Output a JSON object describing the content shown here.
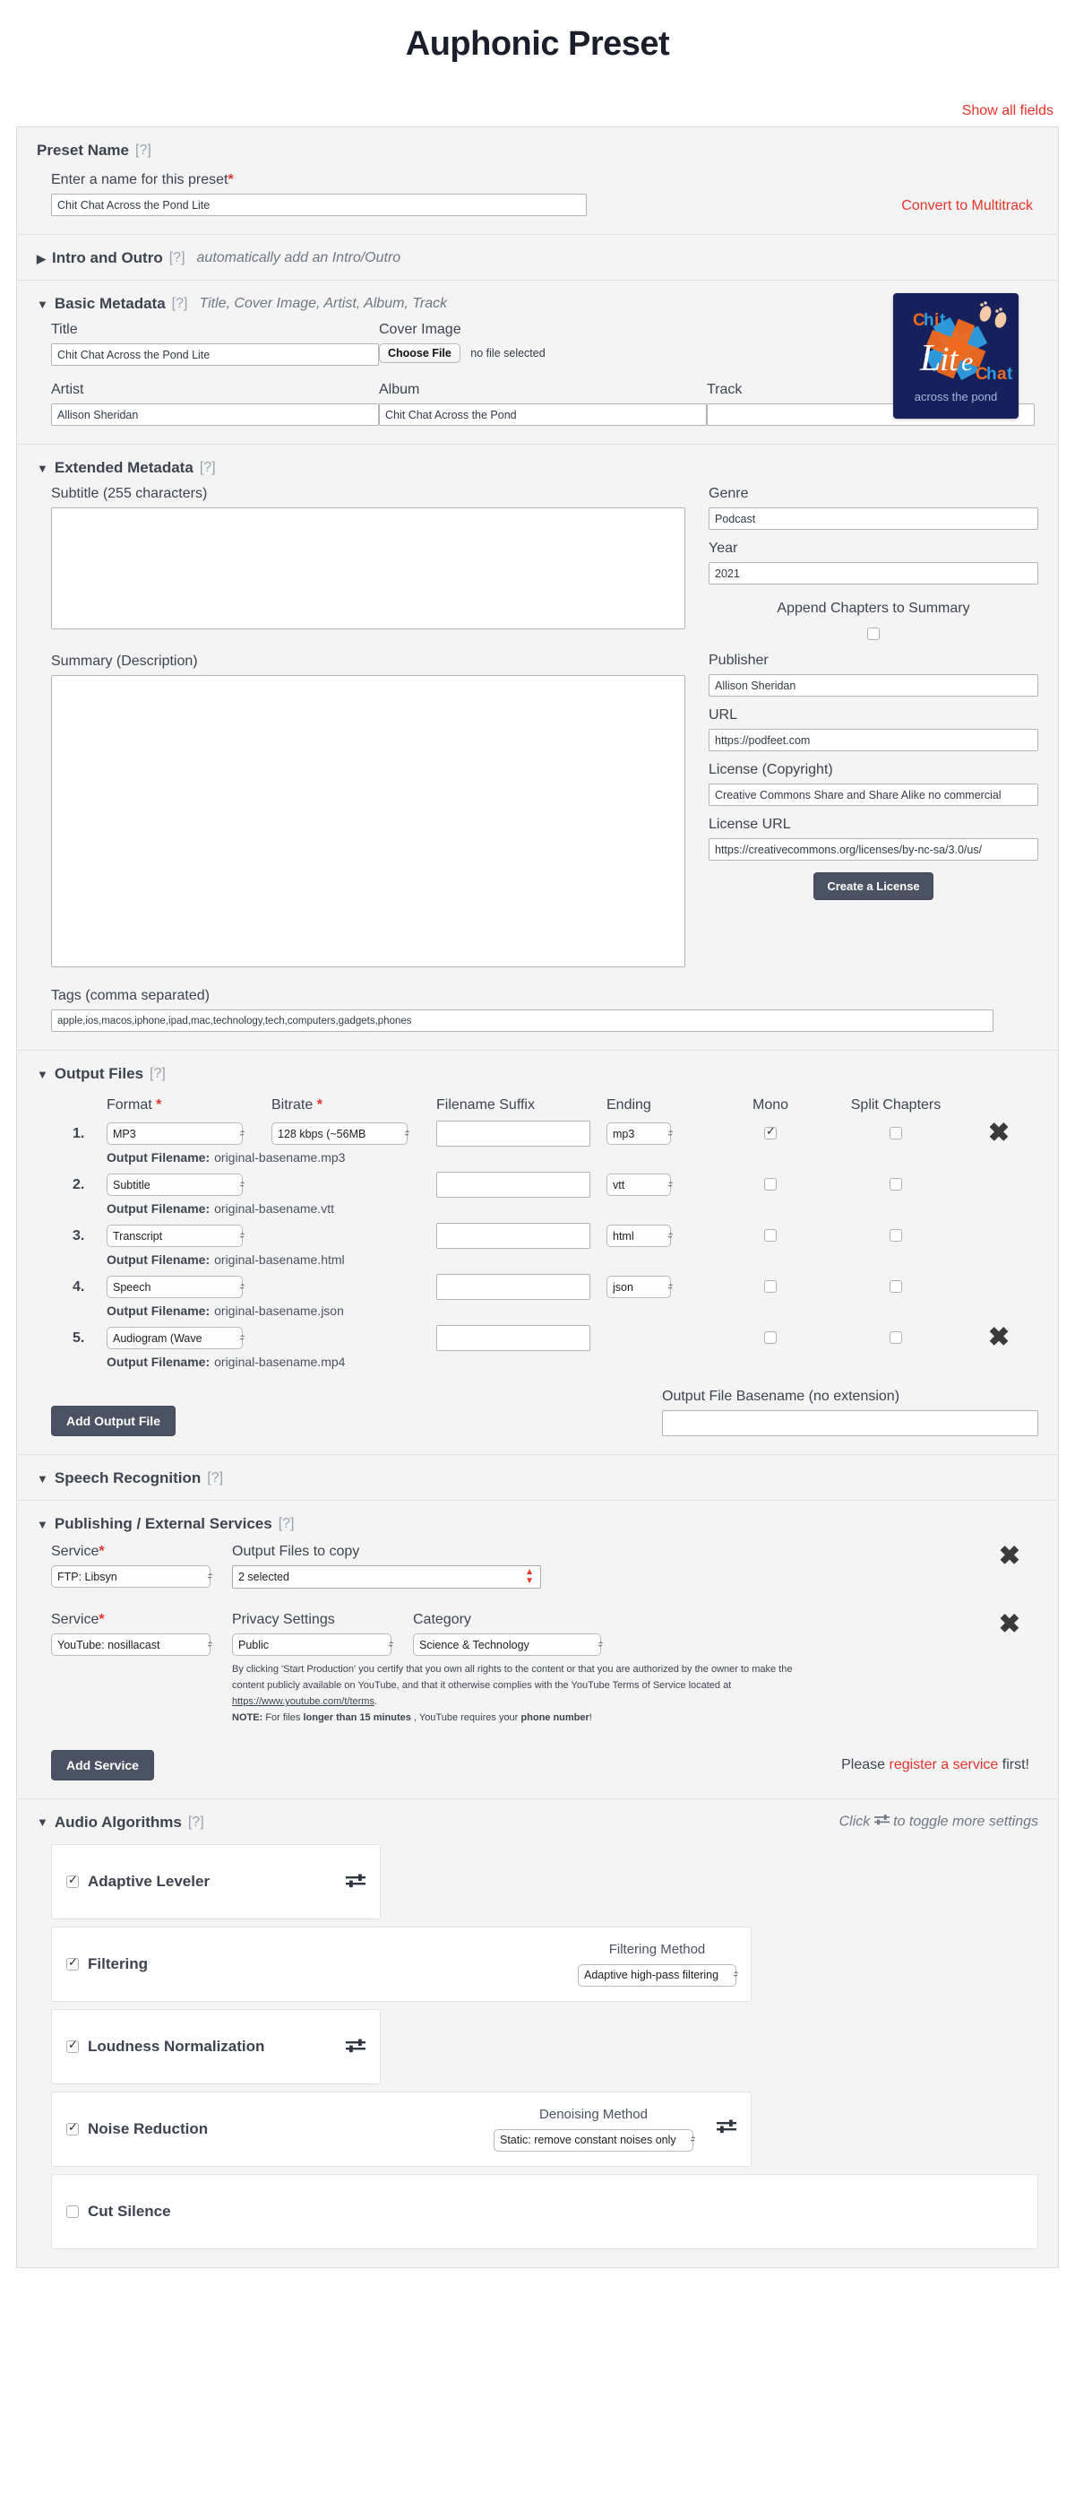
{
  "header": {
    "title": "Auphonic Preset",
    "show_all_fields": "Show all fields"
  },
  "preset_name": {
    "section_title": "Preset Name",
    "help": "[?]",
    "field_label": "Enter a name for this preset",
    "required_mark": "*",
    "value": "Chit Chat Across the Pond Lite",
    "convert_link": "Convert to Multitrack"
  },
  "intro_outro": {
    "section_title": "Intro and Outro",
    "help": "[?]",
    "hint": "automatically add an Intro/Outro",
    "caret": "▶"
  },
  "basic_metadata": {
    "section_title": "Basic Metadata",
    "help": "[?]",
    "hint": "Title, Cover Image, Artist, Album, Track",
    "caret": "▼",
    "title_label": "Title",
    "title_value": "Chit Chat Across the Pond Lite",
    "cover_label": "Cover Image",
    "choose_file": "Choose File",
    "no_file": "no file selected",
    "artist_label": "Artist",
    "artist_value": "Allison Sheridan",
    "album_label": "Album",
    "album_value": "Chit Chat Across the Pond",
    "track_label": "Track",
    "track_value": "",
    "cover_art": {
      "chit": "Chit",
      "lite": "Lite",
      "chat": "Chat",
      "tagline": "across the pond",
      "bg": "#16205a",
      "orange": "#f06a1e",
      "blue": "#2f9ee0"
    }
  },
  "extended_metadata": {
    "section_title": "Extended Metadata",
    "help": "[?]",
    "caret": "▼",
    "subtitle_label": "Subtitle (255 characters)",
    "subtitle_value": "",
    "genre_label": "Genre",
    "genre_value": "Podcast",
    "year_label": "Year",
    "year_value": "2021",
    "append_chapters_label": "Append Chapters to Summary",
    "append_chapters_checked": false,
    "summary_label": "Summary (Description)",
    "summary_value": "",
    "publisher_label": "Publisher",
    "publisher_value": "Allison Sheridan",
    "url_label": "URL",
    "url_value": "https://podfeet.com",
    "license_label": "License (Copyright)",
    "license_value": "Creative Commons Share and Share Alike no commercial",
    "license_url_label": "License URL",
    "license_url_value": "https://creativecommons.org/licenses/by-nc-sa/3.0/us/",
    "create_license_button": "Create a License",
    "tags_label": "Tags (comma separated)",
    "tags_value": "apple,ios,macos,iphone,ipad,mac,technology,tech,computers,gadgets,phones"
  },
  "output_files": {
    "section_title": "Output Files",
    "help": "[?]",
    "caret": "▼",
    "columns": {
      "format": "Format",
      "bitrate": "Bitrate",
      "suffix": "Filename Suffix",
      "ending": "Ending",
      "mono": "Mono",
      "split": "Split Chapters"
    },
    "rows": [
      {
        "index": "1.",
        "format": "MP3",
        "bitrate": "128 kbps (~56MB",
        "suffix": "",
        "ending": "mp3",
        "mono": true,
        "split": false,
        "has_delete": true,
        "filename_label": "Output Filename:",
        "filename_value": "original-basename.mp3"
      },
      {
        "index": "2.",
        "format": "Subtitle",
        "bitrate": "",
        "suffix": "",
        "ending": "vtt",
        "mono": false,
        "split": false,
        "has_delete": false,
        "filename_label": "Output Filename:",
        "filename_value": "original-basename.vtt"
      },
      {
        "index": "3.",
        "format": "Transcript",
        "bitrate": "",
        "suffix": "",
        "ending": "html",
        "mono": false,
        "split": false,
        "has_delete": false,
        "filename_label": "Output Filename:",
        "filename_value": "original-basename.html"
      },
      {
        "index": "4.",
        "format": "Speech",
        "bitrate": "",
        "suffix": "",
        "ending": "json",
        "mono": false,
        "split": false,
        "has_delete": false,
        "filename_label": "Output Filename:",
        "filename_value": "original-basename.json"
      },
      {
        "index": "5.",
        "format": "Audiogram (Wave",
        "bitrate": "",
        "suffix": "",
        "ending": "",
        "mono": false,
        "split": false,
        "has_delete": true,
        "filename_label": "Output Filename:",
        "filename_value": "original-basename.mp4"
      }
    ],
    "add_button": "Add Output File",
    "basename_label": "Output File Basename (no extension)",
    "basename_value": ""
  },
  "speech_recognition": {
    "section_title": "Speech Recognition",
    "help": "[?]",
    "caret": "▼"
  },
  "publishing": {
    "section_title": "Publishing / External Services",
    "help": "[?]",
    "caret": "▼",
    "service_label": "Service",
    "required_mark": "*",
    "row1": {
      "service_value": "FTP: Libsyn",
      "copy_label": "Output Files to copy",
      "copy_value": "2 selected"
    },
    "row2": {
      "service_value": "YouTube: nosillacast",
      "privacy_label": "Privacy Settings",
      "privacy_value": "Public",
      "category_label": "Category",
      "category_value": "Science & Technology",
      "note_line1": "By clicking 'Start Production' you certify that you own all rights to the content or that you are",
      "note_line2": "authorized by the owner to make the content publicly available on YouTube, and that it otherwise",
      "note_line3_pre": "complies with the YouTube Terms of Service located at ",
      "note_link": "https://www.youtube.com/t/terms",
      "note_line3_post": ".",
      "note_bold_note": "NOTE:",
      "note_line4_a": " For files ",
      "note_line4_b": "longer than 15 minutes",
      "note_line4_c": " , YouTube requires your ",
      "note_line4_d": "phone number",
      "note_line4_e": "!"
    },
    "add_service_button": "Add Service",
    "register_pre": "Please ",
    "register_link": "register a service",
    "register_post": " first!"
  },
  "audio_algorithms": {
    "section_title": "Audio Algorithms",
    "help": "[?]",
    "caret": "▼",
    "hint_pre": "Click ",
    "hint_post": " to toggle more settings",
    "cards": [
      {
        "name": "Adaptive Leveler",
        "checked": true,
        "has_slider": true
      },
      {
        "name": "Filtering",
        "checked": true,
        "has_slider": false,
        "method_label": "Filtering Method",
        "method_value": "Adaptive high-pass filtering"
      },
      {
        "name": "Loudness Normalization",
        "checked": true,
        "has_slider": true
      },
      {
        "name": "Noise Reduction",
        "checked": true,
        "has_slider": true,
        "method_label": "Denoising Method",
        "method_value": "Static: remove constant noises only"
      },
      {
        "name": "Cut Silence",
        "checked": false,
        "has_slider": false
      }
    ]
  }
}
